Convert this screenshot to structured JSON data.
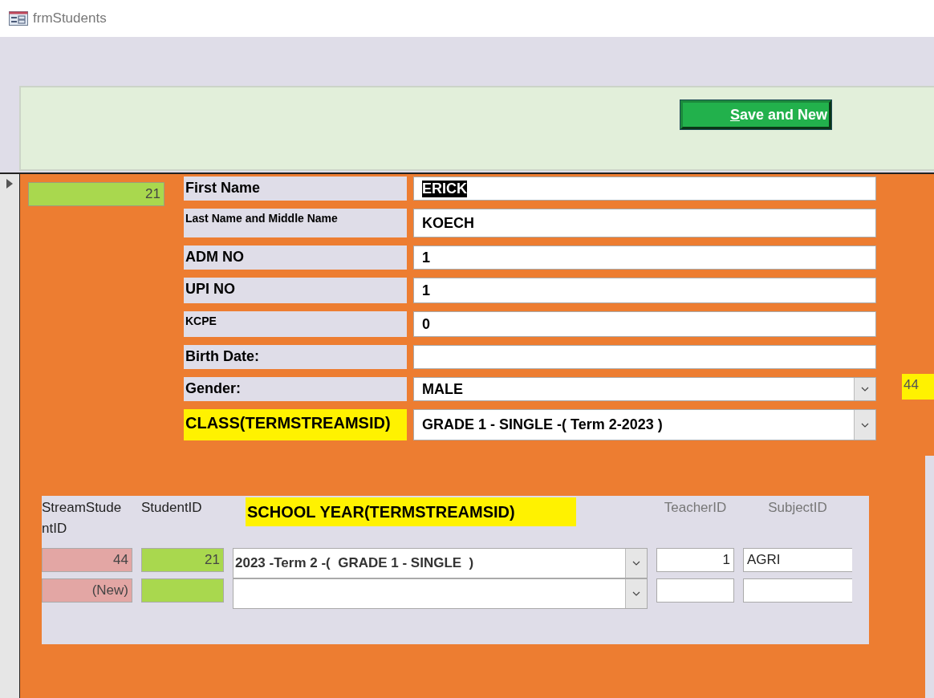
{
  "window": {
    "title": "frmStudents"
  },
  "header": {
    "save_button": "Save and New"
  },
  "record": {
    "current": true,
    "student_id": "21",
    "side_value": "44",
    "fields": [
      {
        "label": {
          "text": "First Name",
          "kind": "normal"
        },
        "value": "ERICK",
        "kind": "text",
        "value_selected": true
      },
      {
        "label": {
          "text": "Last Name and Middle Name",
          "kind": "small"
        },
        "value": "KOECH",
        "kind": "text",
        "value_selected": false
      },
      {
        "label": {
          "text": "ADM NO",
          "kind": "normal"
        },
        "value": "1",
        "kind": "text",
        "value_selected": false
      },
      {
        "label": {
          "text": "UPI NO",
          "kind": "normal"
        },
        "value": "1",
        "kind": "text",
        "value_selected": false
      },
      {
        "label": {
          "text": "KCPE",
          "kind": "small"
        },
        "value": "0",
        "kind": "text",
        "value_selected": false
      },
      {
        "label": {
          "text": "Birth Date:",
          "kind": "normal"
        },
        "kind": "text"
      },
      {
        "label": {
          "text": "Gender:",
          "kind": "normal"
        },
        "value": "MALE",
        "kind": "combo",
        "value_selected": false
      },
      {
        "label": {
          "text": "CLASS(TERMSTREAMSID)",
          "kind": "highlight"
        },
        "value": "GRADE 1 - SINGLE -( Term 2-2023 )",
        "kind": "combo",
        "value_selected": false
      }
    ]
  },
  "subform": {
    "columns": [
      "StreamStudentID",
      "StudentID",
      "SCHOOL YEAR(TERMSTREAMSID)",
      "TeacherID",
      "SubjectID"
    ],
    "rows": [
      {
        "stream_student_id": "44",
        "student_id": "21",
        "school_year": "2023 -Term 2 -(  GRADE 1 - SINGLE  )",
        "teacher_id": "1",
        "subject_id": "AGRI"
      },
      {
        "stream_student_id": "(New)"
      }
    ]
  }
}
